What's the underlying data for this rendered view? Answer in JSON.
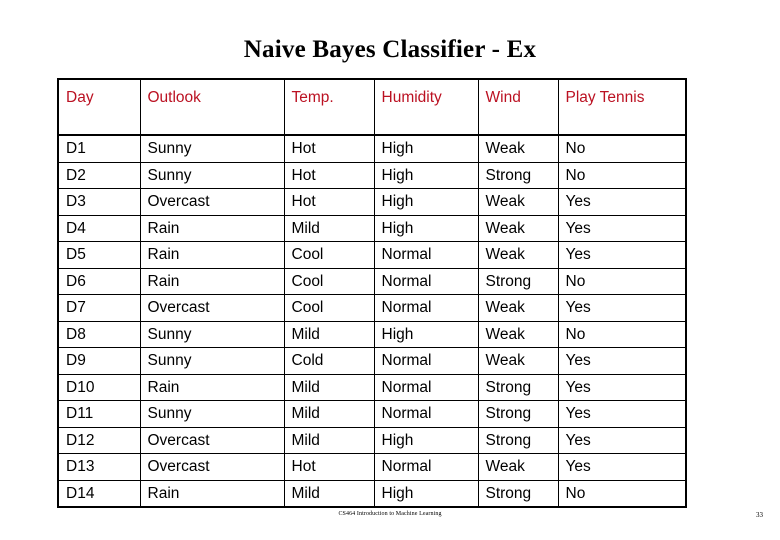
{
  "slide": {
    "title": "Naive Bayes Classifier - Ex",
    "footer": "CS464 Introduction to Machine Learning",
    "page_number": "33",
    "header_text_color": "#bb1122",
    "body_text_color": "#000000",
    "background_color": "#ffffff",
    "border_color": "#000000"
  },
  "table": {
    "columns": [
      {
        "key": "day",
        "label": "Day"
      },
      {
        "key": "outlook",
        "label": "Outlook"
      },
      {
        "key": "temp",
        "label": "Temp."
      },
      {
        "key": "humidity",
        "label": "Humidity"
      },
      {
        "key": "wind",
        "label": "Wind"
      },
      {
        "key": "play",
        "label": "Play Tennis"
      }
    ],
    "rows": [
      {
        "day": "D1",
        "outlook": "Sunny",
        "temp": "Hot",
        "humidity": "High",
        "wind": "Weak",
        "play": "No"
      },
      {
        "day": "D2",
        "outlook": "Sunny",
        "temp": "Hot",
        "humidity": "High",
        "wind": "Strong",
        "play": "No"
      },
      {
        "day": "D3",
        "outlook": "Overcast",
        "temp": "Hot",
        "humidity": "High",
        "wind": "Weak",
        "play": "Yes"
      },
      {
        "day": "D4",
        "outlook": "Rain",
        "temp": "Mild",
        "humidity": "High",
        "wind": "Weak",
        "play": "Yes"
      },
      {
        "day": "D5",
        "outlook": "Rain",
        "temp": "Cool",
        "humidity": "Normal",
        "wind": "Weak",
        "play": "Yes"
      },
      {
        "day": "D6",
        "outlook": "Rain",
        "temp": "Cool",
        "humidity": "Normal",
        "wind": "Strong",
        "play": "No"
      },
      {
        "day": "D7",
        "outlook": "Overcast",
        "temp": "Cool",
        "humidity": "Normal",
        "wind": "Weak",
        "play": "Yes"
      },
      {
        "day": "D8",
        "outlook": "Sunny",
        "temp": "Mild",
        "humidity": "High",
        "wind": "Weak",
        "play": "No"
      },
      {
        "day": "D9",
        "outlook": "Sunny",
        "temp": "Cold",
        "humidity": "Normal",
        "wind": "Weak",
        "play": "Yes"
      },
      {
        "day": "D10",
        "outlook": "Rain",
        "temp": "Mild",
        "humidity": "Normal",
        "wind": "Strong",
        "play": "Yes"
      },
      {
        "day": "D11",
        "outlook": "Sunny",
        "temp": "Mild",
        "humidity": "Normal",
        "wind": "Strong",
        "play": "Yes"
      },
      {
        "day": "D12",
        "outlook": "Overcast",
        "temp": "Mild",
        "humidity": "High",
        "wind": "Strong",
        "play": "Yes"
      },
      {
        "day": "D13",
        "outlook": "Overcast",
        "temp": "Hot",
        "humidity": "Normal",
        "wind": "Weak",
        "play": "Yes"
      },
      {
        "day": "D14",
        "outlook": "Rain",
        "temp": "Mild",
        "humidity": "High",
        "wind": "Strong",
        "play": "No"
      }
    ]
  }
}
